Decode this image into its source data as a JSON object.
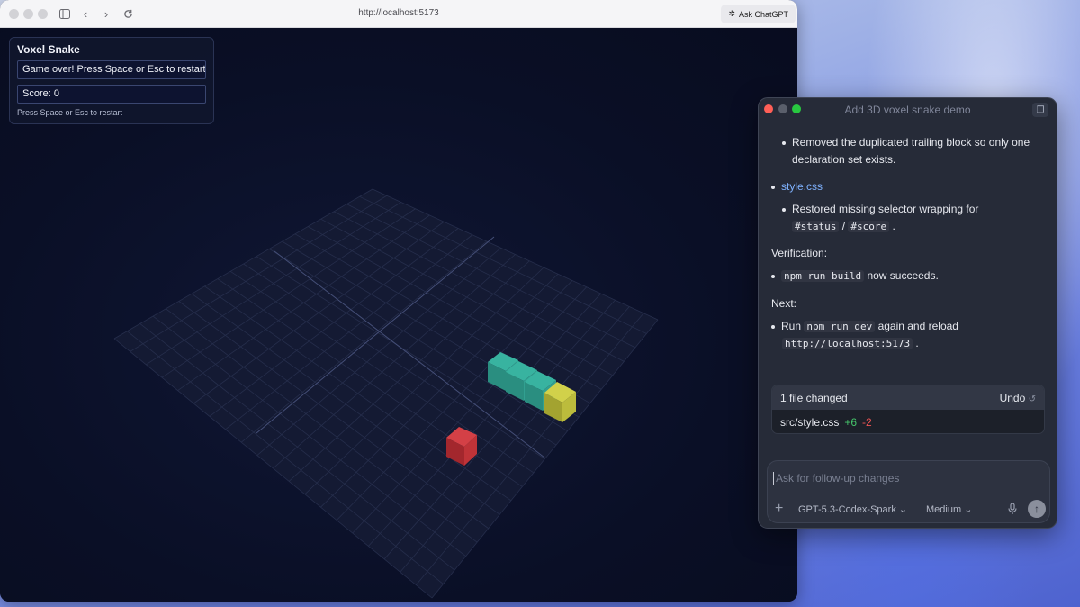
{
  "browser": {
    "url": "http://localhost:5173",
    "ask_label": "Ask ChatGPT"
  },
  "game": {
    "title": "Voxel Snake",
    "status": "Game over! Press Space or Esc to restart.",
    "score": "Score: 0",
    "hint": "Press Space or Esc to restart",
    "colors": {
      "snake_body": "#2f9e8f",
      "snake_head": "#b8b838",
      "food": "#c0353a",
      "grid": "#2a3150"
    }
  },
  "codex": {
    "title": "Add 3D voxel snake demo",
    "messages": {
      "l1": "Removed the duplicated trailing block so only one",
      "l2": "declaration set exists.",
      "file_link": "style.css",
      "l3": "Restored missing selector wrapping for",
      "code_status": "#status",
      "sep": "/",
      "code_score": "#score",
      "period": ".",
      "verification": "Verification:",
      "code_build": "npm run build",
      "build_tail": "now succeeds.",
      "next": "Next:",
      "run": "Run",
      "code_dev": "npm run dev",
      "dev_tail": "again and reload",
      "code_url": "http://localhost:5173"
    },
    "changes": {
      "summary": "1 file changed",
      "undo": "Undo",
      "file": "src/style.css",
      "added": "+6",
      "removed": "-2"
    },
    "composer": {
      "placeholder": "Ask for follow-up changes",
      "model": "GPT-5.3-Codex-Spark",
      "effort": "Medium"
    }
  }
}
